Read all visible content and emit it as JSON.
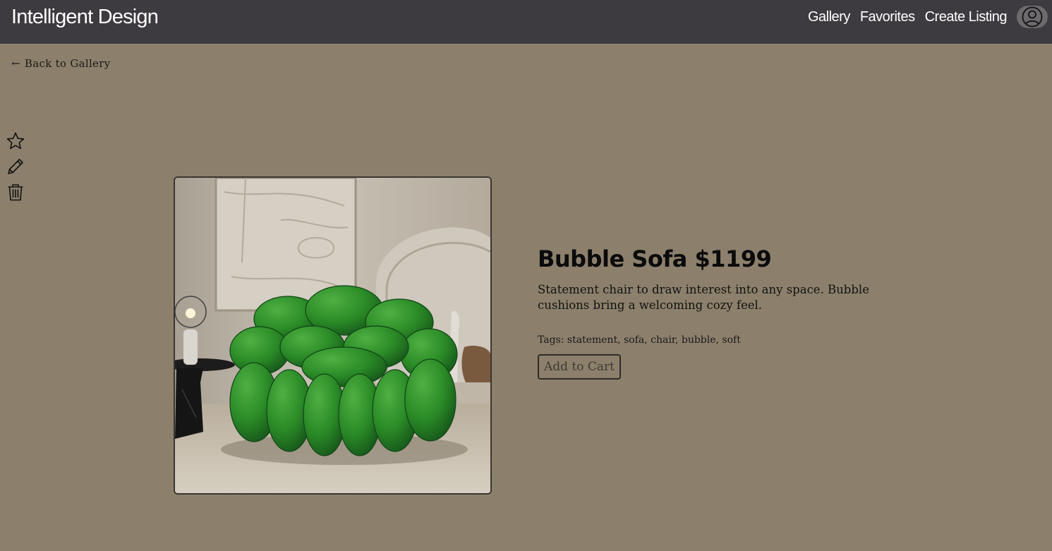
{
  "header": {
    "brand": "Intelligent Design",
    "nav": [
      {
        "label": "Gallery"
      },
      {
        "label": "Favorites"
      },
      {
        "label": "Create Listing"
      }
    ],
    "account_icon": "user-circle-icon"
  },
  "back_link": {
    "arrow": "←",
    "label": "Back to Gallery"
  },
  "actions": {
    "favorite_icon": "star-icon",
    "edit_icon": "pencil-icon",
    "delete_icon": "trash-icon"
  },
  "product": {
    "title": "Bubble Sofa $1199",
    "description": "Statement chair to draw interest into any space. Bubble cushions bring a welcoming cozy feel.",
    "tags": "Tags: statement, sofa, chair, bubble, soft",
    "cart_label": "Add to Cart"
  },
  "colors": {
    "page_background": "#8c806c",
    "navbar": "#3d3a40",
    "sofa_green": "#2e8a2a"
  }
}
